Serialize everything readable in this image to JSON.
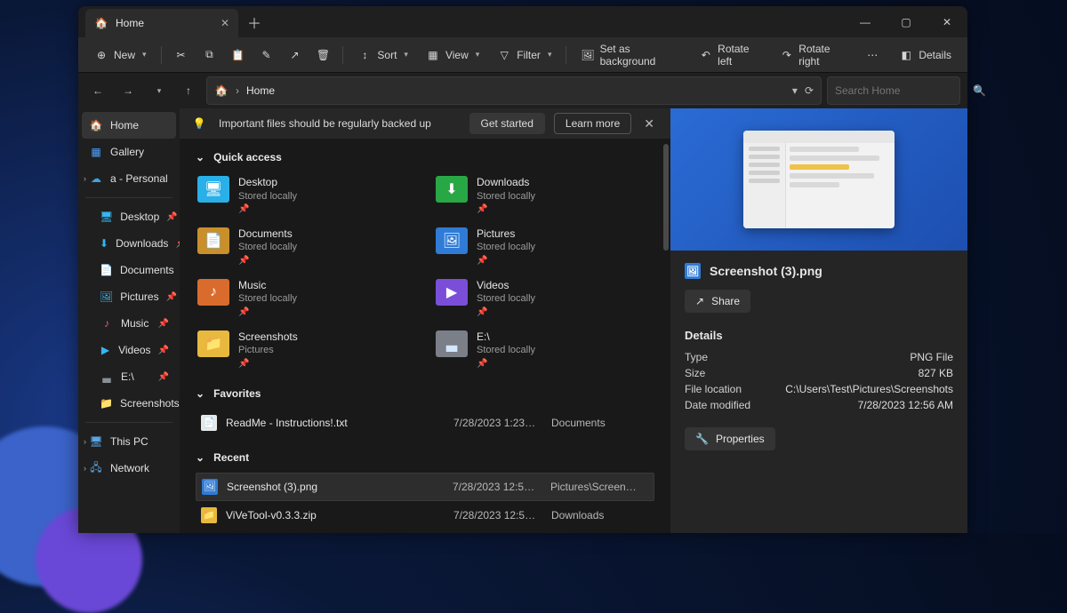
{
  "window": {
    "tab_title": "Home"
  },
  "toolbar": {
    "new": "New",
    "sort": "Sort",
    "view": "View",
    "filter": "Filter",
    "set_bg": "Set as background",
    "rotate_left": "Rotate left",
    "rotate_right": "Rotate right",
    "details": "Details"
  },
  "address": {
    "path": "Home"
  },
  "search": {
    "placeholder": "Search Home"
  },
  "sidebar": {
    "top": [
      {
        "label": "Home",
        "selected": true
      },
      {
        "label": "Gallery"
      },
      {
        "label": "a - Personal",
        "expandable": true
      }
    ],
    "pinned": [
      {
        "label": "Desktop"
      },
      {
        "label": "Downloads"
      },
      {
        "label": "Documents"
      },
      {
        "label": "Pictures"
      },
      {
        "label": "Music"
      },
      {
        "label": "Videos"
      },
      {
        "label": "E:\\"
      },
      {
        "label": "Screenshots"
      }
    ],
    "bottom": [
      {
        "label": "This PC"
      },
      {
        "label": "Network"
      }
    ]
  },
  "banner": {
    "text": "Important files should be regularly backed up",
    "get_started": "Get started",
    "learn_more": "Learn more"
  },
  "sections": {
    "quick_access": "Quick access",
    "favorites": "Favorites",
    "recent": "Recent"
  },
  "quick_access": [
    {
      "name": "Desktop",
      "sub": "Stored locally"
    },
    {
      "name": "Downloads",
      "sub": "Stored locally"
    },
    {
      "name": "Documents",
      "sub": "Stored locally"
    },
    {
      "name": "Pictures",
      "sub": "Stored locally"
    },
    {
      "name": "Music",
      "sub": "Stored locally"
    },
    {
      "name": "Videos",
      "sub": "Stored locally"
    },
    {
      "name": "Screenshots",
      "sub": "Pictures"
    },
    {
      "name": "E:\\",
      "sub": "Stored locally"
    }
  ],
  "favorites": [
    {
      "name": "ReadMe - Instructions!.txt",
      "date": "7/28/2023 1:23…",
      "loc": "Documents"
    }
  ],
  "recent": [
    {
      "name": "Screenshot (3).png",
      "date": "7/28/2023 12:5…",
      "loc": "Pictures\\Screen…",
      "selected": true
    },
    {
      "name": "ViVeTool-v0.3.3.zip",
      "date": "7/28/2023 12:5…",
      "loc": "Downloads"
    }
  ],
  "details": {
    "filename": "Screenshot (3).png",
    "share": "Share",
    "heading": "Details",
    "rows": {
      "type_k": "Type",
      "type_v": "PNG File",
      "size_k": "Size",
      "size_v": "827 KB",
      "loc_k": "File location",
      "loc_v": "C:\\Users\\Test\\Pictures\\Screenshots",
      "mod_k": "Date modified",
      "mod_v": "7/28/2023 12:56 AM"
    },
    "properties": "Properties"
  }
}
